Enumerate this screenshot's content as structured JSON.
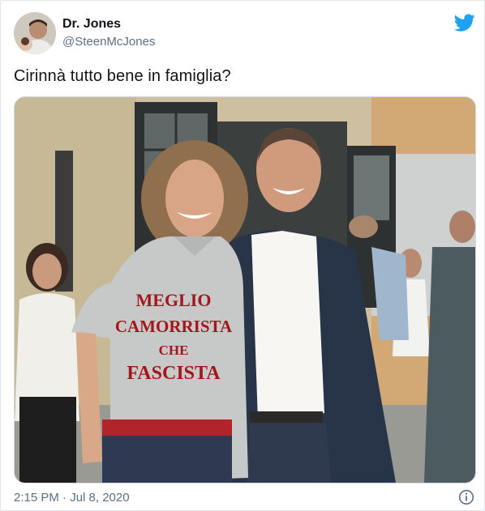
{
  "tweet": {
    "display_name": "Dr. Jones",
    "handle": "@SteenMcJones",
    "text": "Cirinnà tutto bene in famiglia?",
    "timestamp": "2:15 PM · Jul 8, 2020"
  },
  "photo": {
    "shirt_lines": [
      "MEGLIO",
      "CAMORRISTA",
      "CHE",
      "FASCISTA"
    ]
  },
  "icons": {
    "brand": "twitter-bird-icon",
    "info": "info-icon"
  },
  "colors": {
    "twitter_blue": "#1da1f2",
    "shirt_text_red": "#a3161b"
  }
}
